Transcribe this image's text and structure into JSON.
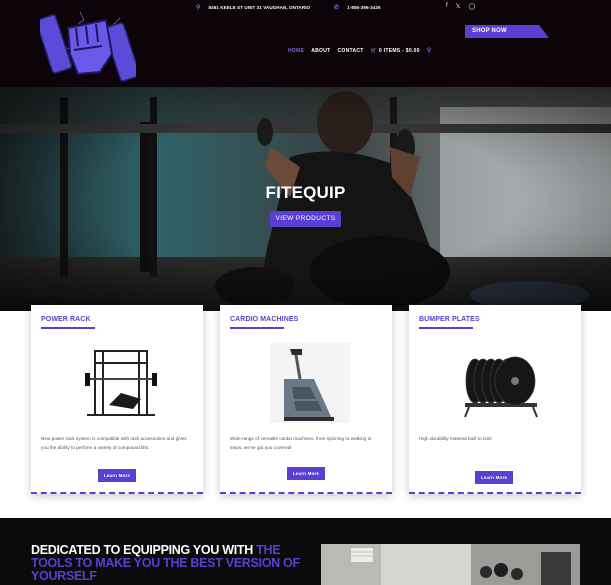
{
  "header": {
    "address": "8461 KEELE ST UNIT 31 VAUGHAN, ONTARIO",
    "phone": "1-855-396-3426",
    "shop_label": "SHOP NOW",
    "nav": [
      {
        "label": "HOME",
        "active": true
      },
      {
        "label": "ABOUT",
        "active": false
      },
      {
        "label": "CONTACT",
        "active": false
      },
      {
        "label": "0 ITEMS - $0.00",
        "active": false
      }
    ],
    "social": [
      "facebook-icon",
      "x-icon",
      "instagram-icon"
    ]
  },
  "hero": {
    "title": "FITEQUIP",
    "button_label": "VIEW PRODUCTS"
  },
  "cards": [
    {
      "title": "POWER RACK",
      "text": "New power rack system is compatible with rack accessories and gives you the ability to perform a variety of compound lifts.",
      "button_label": "Learn More"
    },
    {
      "title": "CARDIO MACHINES",
      "text": "Wide range of versatile cardio machines, from spinning to walking or steps, we've got you covered!",
      "button_label": "Learn More"
    },
    {
      "title": "BUMPER PLATES",
      "text": "High durability material built to last!",
      "button_label": "Learn More"
    }
  ],
  "bottom": {
    "tagline_white": "DEDICATED TO EQUIPPING YOU WITH ",
    "tagline_accent": "THE TOOLS TO MAKE YOU THE BEST VERSION OF YOURSELF"
  },
  "colors": {
    "accent": "#5a3fd0",
    "header_bg": "#0d0409",
    "nav_active": "#7b6cf0"
  }
}
